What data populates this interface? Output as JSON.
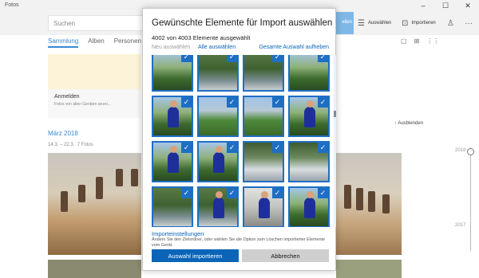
{
  "app": {
    "window_title": "Fotos",
    "search_placeholder": "Suchen",
    "toolbar": {
      "import_label_partial": "ellen",
      "select_label": "Auswählen",
      "import_label": "Importieren"
    },
    "tabs": [
      {
        "label": "Sammlung",
        "active": true
      },
      {
        "label": "Alben",
        "active": false
      },
      {
        "label": "Personen",
        "active": false
      }
    ],
    "promo": {
      "title": "Anmelden",
      "subtitle": "Fotos von allen Geräten anzei..."
    },
    "date_group": {
      "heading": "März 2018",
      "range": "14.3. – 22.3.",
      "count": "7 Fotos"
    },
    "hide_label": "Ausblenden",
    "timeline_years": [
      "2018",
      "2017"
    ],
    "accent_color": "#0a64b8"
  },
  "dialog": {
    "title": "Gewünschte Elemente für Import auswählen",
    "count_text": "4002 von 4003 Elemente ausgewählt",
    "select_new": "Neu auswählen",
    "select_all": "Alle auswählen",
    "clear_selection": "Gesamte Auswahl aufheben",
    "settings_title": "Importeinstellungen",
    "settings_desc": "Ändern Sie den Zielordner, oder wählen Sie die Option zum Löschen importierter Elemente vom Gerät.",
    "import_button": "Auswahl importieren",
    "cancel_button": "Abbrechen",
    "thumbnails": [
      {
        "kind": "t1",
        "person": false,
        "checked": true
      },
      {
        "kind": "t4",
        "person": false,
        "checked": true
      },
      {
        "kind": "t4",
        "person": false,
        "checked": true
      },
      {
        "kind": "t1",
        "person": false,
        "checked": true
      },
      {
        "kind": "t1",
        "person": true,
        "checked": true
      },
      {
        "kind": "t2",
        "person": false,
        "checked": true
      },
      {
        "kind": "t2",
        "person": false,
        "checked": true
      },
      {
        "kind": "t1",
        "person": true,
        "checked": true
      },
      {
        "kind": "t1",
        "person": true,
        "checked": true
      },
      {
        "kind": "t1",
        "person": true,
        "checked": true
      },
      {
        "kind": "t3",
        "person": false,
        "checked": true
      },
      {
        "kind": "t3",
        "person": false,
        "checked": true
      },
      {
        "kind": "t4",
        "person": false,
        "checked": true
      },
      {
        "kind": "t4",
        "person": true,
        "checked": true
      },
      {
        "kind": "t5",
        "person": true,
        "checked": true
      },
      {
        "kind": "t1",
        "person": true,
        "checked": true
      },
      {
        "kind": "t5",
        "person": false,
        "checked": true
      },
      {
        "kind": "t5",
        "person": false,
        "checked": true
      },
      {
        "kind": "t5",
        "person": true,
        "checked": true
      },
      {
        "kind": "t5",
        "person": true,
        "checked": true
      }
    ]
  }
}
